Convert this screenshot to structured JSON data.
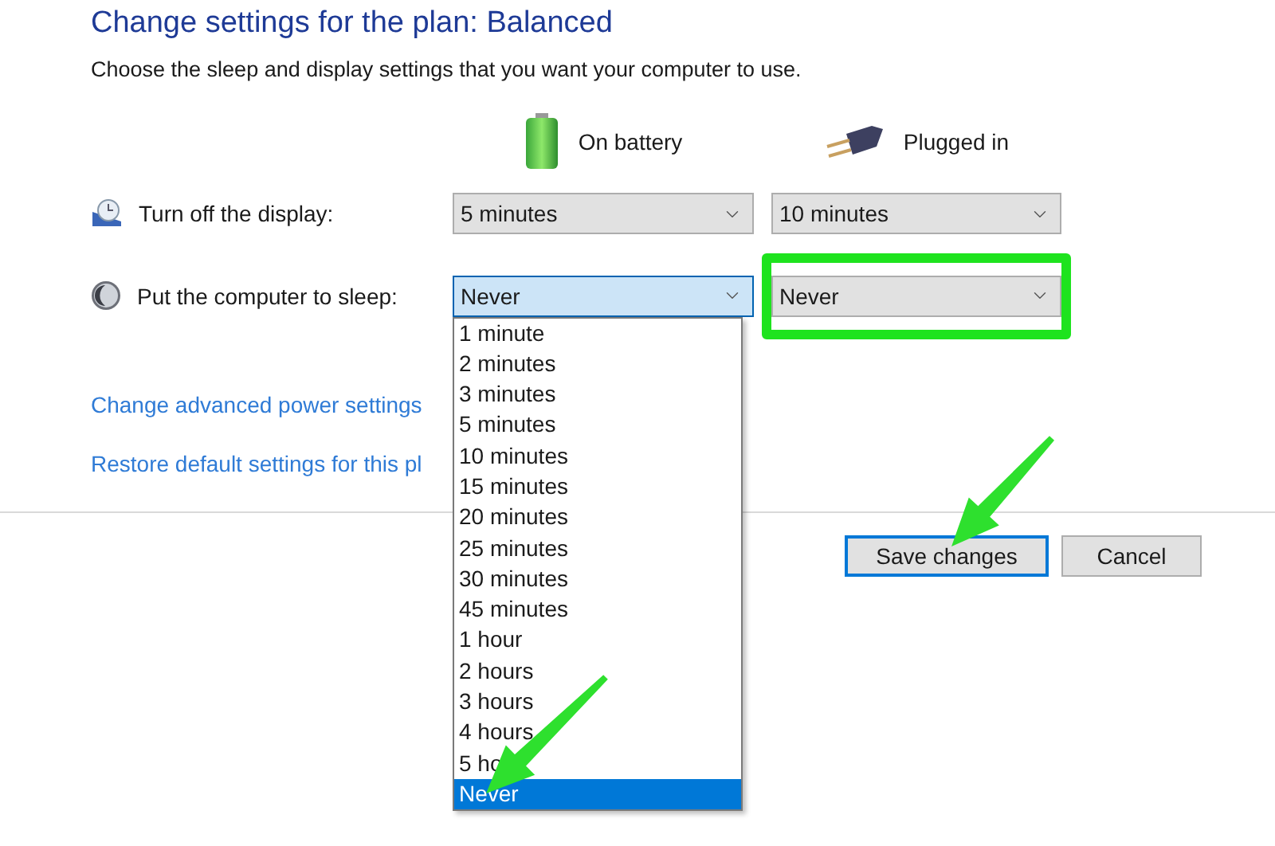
{
  "title": "Change settings for the plan: Balanced",
  "subtitle": "Choose the sleep and display settings that you want your computer to use.",
  "columns": [
    {
      "label": "On battery",
      "kind": "battery"
    },
    {
      "label": "Plugged in",
      "kind": "plug"
    }
  ],
  "settings": [
    {
      "label": "Turn off the display:",
      "kind": "display",
      "selects": [
        {
          "value": "5 minutes",
          "open": false,
          "highlighted": false
        },
        {
          "value": "10 minutes",
          "open": false,
          "highlighted": false
        }
      ]
    },
    {
      "label": "Put the computer to sleep:",
      "kind": "sleep",
      "selects": [
        {
          "value": "Never",
          "open": true,
          "highlighted": false
        },
        {
          "value": "Never",
          "open": false,
          "highlighted": true
        }
      ]
    }
  ],
  "open_list": [
    {
      "label": "1 minute",
      "selected": false
    },
    {
      "label": "2 minutes",
      "selected": false
    },
    {
      "label": "3 minutes",
      "selected": false
    },
    {
      "label": "5 minutes",
      "selected": false
    },
    {
      "label": "10 minutes",
      "selected": false
    },
    {
      "label": "15 minutes",
      "selected": false
    },
    {
      "label": "20 minutes",
      "selected": false
    },
    {
      "label": "25 minutes",
      "selected": false
    },
    {
      "label": "30 minutes",
      "selected": false
    },
    {
      "label": "45 minutes",
      "selected": false
    },
    {
      "label": "1 hour",
      "selected": false
    },
    {
      "label": "2 hours",
      "selected": false
    },
    {
      "label": "3 hours",
      "selected": false
    },
    {
      "label": "4 hours",
      "selected": false
    },
    {
      "label": "5 ho",
      "selected": false
    },
    {
      "label": "Never",
      "selected": true
    }
  ],
  "links": [
    "Change advanced power settings",
    "Restore default settings for this pl"
  ],
  "buttons": [
    {
      "label": "Save changes",
      "default": true
    },
    {
      "label": "Cancel",
      "default": false
    }
  ]
}
